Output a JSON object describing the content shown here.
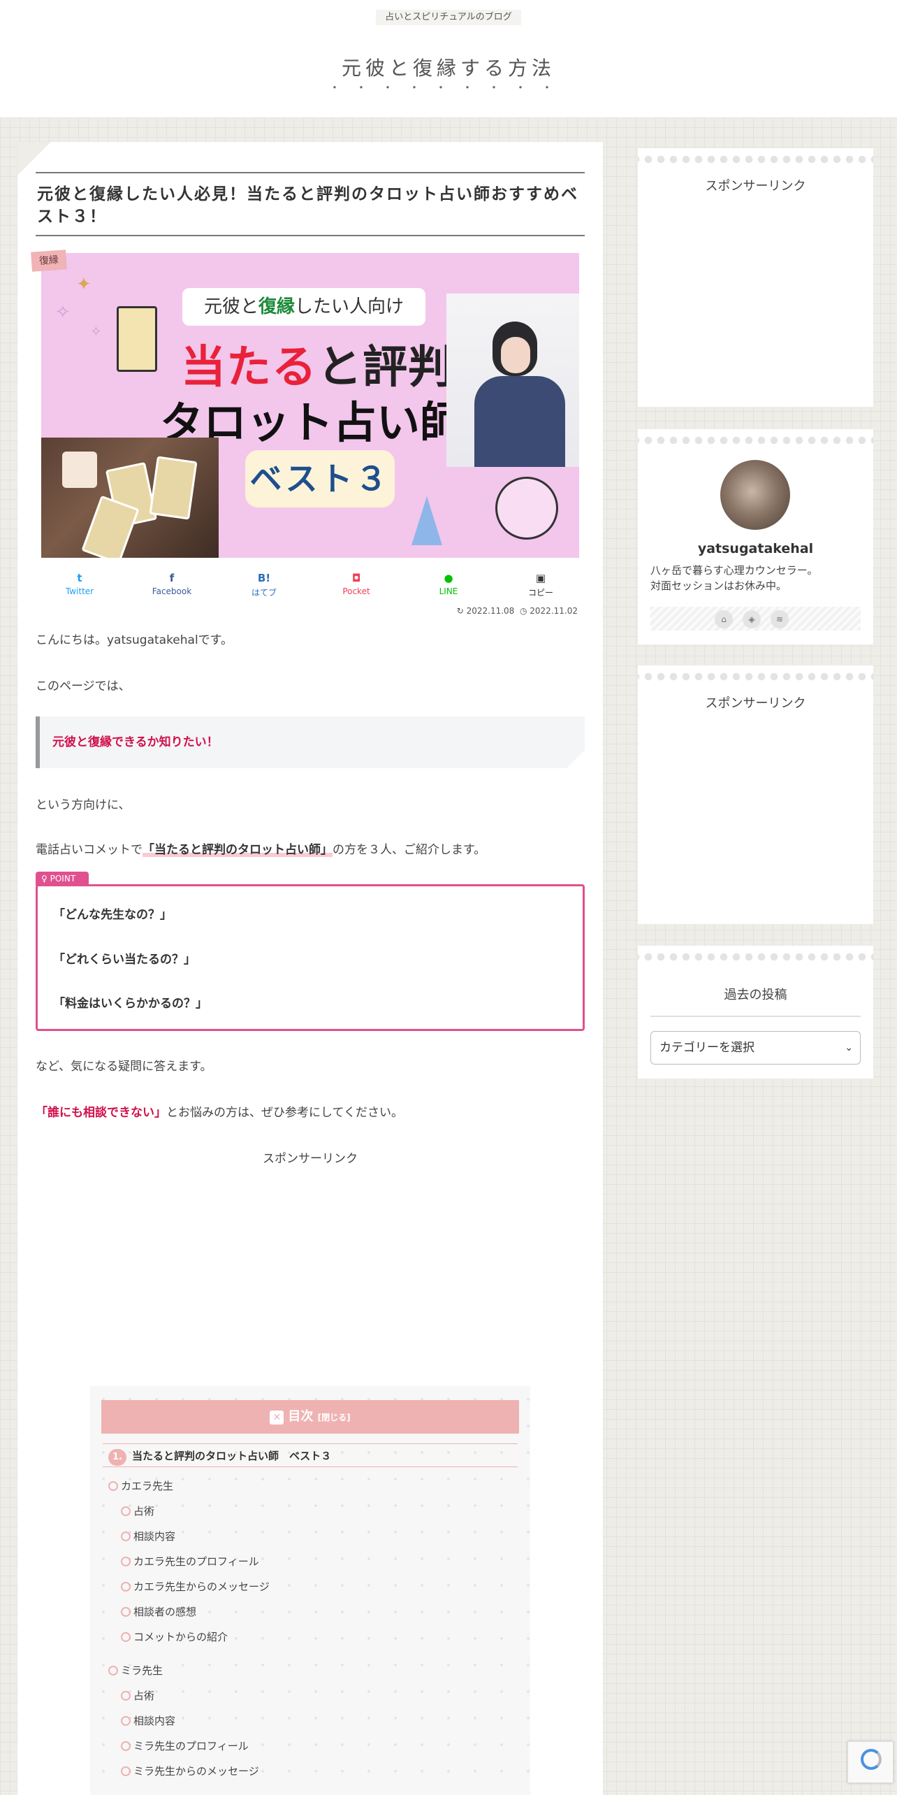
{
  "header": {
    "tagline": "占いとスピリチュアルのブログ",
    "site_title": "元彼と復縁する方法",
    "title_dots": "・・・・・・・・・"
  },
  "post": {
    "title": "元彼と復縁したい人必見！当たると評判のタロット占い師おすすめベスト３！",
    "category": "復縁",
    "eyecatch": {
      "banner_pre": "元彼と",
      "banner_hl": "復縁",
      "banner_post": "したい人向け",
      "big1_red": "当たる",
      "big1_rest": "と評判",
      "big2": "タロット占い師",
      "best": "ベスト３"
    },
    "share": [
      {
        "label": "Twitter",
        "icon": "t",
        "color": "#1da1f2"
      },
      {
        "label": "Facebook",
        "icon": "f",
        "color": "#3b5998"
      },
      {
        "label": "はてブ",
        "icon": "B!",
        "color": "#2c6ebd"
      },
      {
        "label": "Pocket",
        "icon": "◘",
        "color": "#ef4056"
      },
      {
        "label": "LINE",
        "icon": "●",
        "color": "#00c300"
      },
      {
        "label": "コピー",
        "icon": "▣",
        "color": "#333333"
      }
    ],
    "date_updated": "2022.11.08",
    "date_published": "2022.11.02",
    "p1": "こんにちは。yatsugatakehalです。",
    "p2": "このページでは、",
    "quote": "元彼と復縁できるか知りたい！",
    "p3": "という方向けに、",
    "p4_pre": "電話占いコメットで",
    "p4_marker": "「当たると評判のタロット占い師」",
    "p4_post": "の方を３人、ご紹介します。",
    "point_label": "POINT",
    "point_lines": [
      "「どんな先生なの？」",
      "「どれくらい当たるの？」",
      "「料金はいくらかかるの？」"
    ],
    "p5": "など、気になる疑問に答えます。",
    "p6_red": "「誰にも相談できない」",
    "p6_post": "とお悩みの方は、ぜひ参考にしてください。",
    "sponsor": "スポンサーリンク"
  },
  "toc": {
    "title": "目次",
    "close": "[閉じる]",
    "h2_num": "1.",
    "h2": "当たると評判のタロット占い師　ベスト３",
    "items": [
      "カエラ先生",
      "占術",
      "相談内容",
      "カエラ先生のプロフィール",
      "カエラ先生からのメッセージ",
      "相談者の感想",
      "コメットからの紹介",
      "ミラ先生",
      "占術",
      "相談内容",
      "ミラ先生のプロフィール",
      "ミラ先生からのメッセージ"
    ]
  },
  "sidebar": {
    "sponsor1": "スポンサーリンク",
    "profile_name": "yatsugatakehal",
    "profile_desc_1": "八ヶ岳で暮らす心理カウンセラー。",
    "profile_desc_2": "対面セッションはお休み中。",
    "profile_icons": [
      "home-icon",
      "feedly-icon",
      "rss-icon"
    ],
    "sponsor2": "スポンサーリンク",
    "archive_title": "過去の投稿",
    "archive_select": "カテゴリーを選択"
  }
}
